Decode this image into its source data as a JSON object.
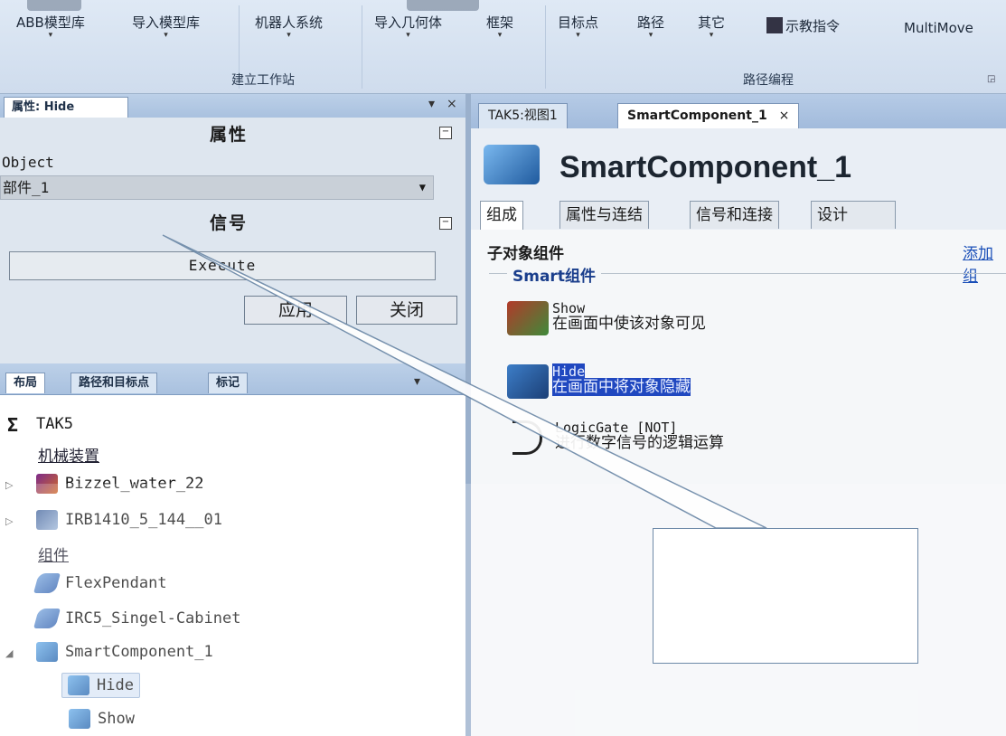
{
  "ribbon": {
    "buttons": [
      {
        "label": "ABB模型库"
      },
      {
        "label": "导入模型库"
      },
      {
        "label": "机器人系统"
      },
      {
        "label": "导入几何体"
      },
      {
        "label": "框架"
      },
      {
        "label": "目标点"
      },
      {
        "label": "路径"
      },
      {
        "label": "其它"
      },
      {
        "label": "示教指令"
      },
      {
        "label": "MultiMove"
      }
    ],
    "groups": [
      {
        "label": "建立工作站"
      },
      {
        "label": "路径编程"
      }
    ]
  },
  "properties_panel": {
    "tab": "属性: Hide",
    "pin": "▾",
    "close": "×",
    "section_props": "属性",
    "object_label": "Object",
    "object_value": "部件_1",
    "section_signals": "信号",
    "execute_label": "Execute",
    "apply": "应用",
    "close_btn": "关闭",
    "collapse_glyph": "−"
  },
  "layout_panel": {
    "tabs": [
      "布局",
      "路径和目标点",
      "标记"
    ],
    "dropdown": "▾",
    "tree": [
      {
        "label": "TAK5"
      },
      {
        "label": "机械装置"
      },
      {
        "label": "Bizzel_water_22"
      },
      {
        "label": "IRB1410_5_144__01"
      },
      {
        "label": "组件"
      },
      {
        "label": "FlexPendant"
      },
      {
        "label": "IRC5_Singel-Cabinet"
      },
      {
        "label": "SmartComponent_1"
      },
      {
        "label": "Hide"
      },
      {
        "label": "Show"
      }
    ]
  },
  "document": {
    "tabs": [
      "TAK5:视图1",
      "SmartComponent_1"
    ],
    "tab_close": "×",
    "title": "SmartComponent_1",
    "subtabs": [
      "组成",
      "属性与连结",
      "信号和连接",
      "设计"
    ],
    "child_components_title": "子对象组件",
    "add_link": "添加组",
    "smart_group_title": "Smart组件",
    "components": [
      {
        "name": "Show",
        "desc": "在画面中使该对象可见"
      },
      {
        "name": "Hide",
        "desc": "在画面中将对象隐藏"
      },
      {
        "name": "LogicGate [NOT]",
        "desc": "进行数字信号的逻辑运算"
      }
    ]
  },
  "icons": {
    "robot": "robot-icon",
    "library": "library-component-icon",
    "smart": "smart-component-icon",
    "tool": "tool-icon",
    "station": "station-sigma-icon"
  }
}
